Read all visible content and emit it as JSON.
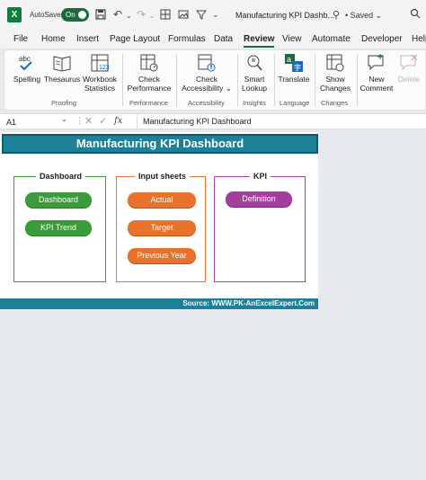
{
  "titlebar": {
    "app_logo": "X",
    "autosave_label": "AutoSave",
    "autosave_state": "On",
    "doc_title": "Manufacturing KPI Dashb...",
    "saved_status": "• Saved ⌄",
    "icons": [
      "save-icon",
      "undo-icon",
      "redo-icon",
      "table-icon",
      "image-icon",
      "filter-icon",
      "more-icon",
      "user-icon",
      "search-icon"
    ]
  },
  "menu": {
    "tabs": [
      "File",
      "Home",
      "Insert",
      "Page Layout",
      "Formulas",
      "Data",
      "Review",
      "View",
      "Automate",
      "Developer",
      "Help"
    ],
    "active": "Review"
  },
  "ribbon": {
    "spelling": "Spelling",
    "thesaurus": "Thesaurus",
    "workbook_stats_1": "Workbook",
    "workbook_stats_2": "Statistics",
    "proofing": "Proofing",
    "check_perf_1": "Check",
    "check_perf_2": "Performance",
    "performance": "Performance",
    "check_access_1": "Check",
    "check_access_2": "Accessibility ⌄",
    "accessibility": "Accessibility",
    "smart_lookup_1": "Smart",
    "smart_lookup_2": "Lookup",
    "insights": "Insights",
    "translate": "Translate",
    "language": "Language",
    "show_changes_1": "Show",
    "show_changes_2": "Changes",
    "changes": "Changes",
    "new_comment_1": "New",
    "new_comment_2": "Comment",
    "delete": "Delete",
    "abc_text": "abc"
  },
  "formula_bar": {
    "name_box": "A1",
    "fx": "fx",
    "content": "Manufacturing KPI Dashboard"
  },
  "dashboard": {
    "title": "Manufacturing KPI Dashboard",
    "footer": "Source: WWW.PK-AnExcelExpert.Com",
    "panels": [
      {
        "title": "Dashboard",
        "buttons": [
          "Dashboard",
          "KPI Trend"
        ],
        "color": "#3a9b3a"
      },
      {
        "title": "Input sheets",
        "buttons": [
          "Actual",
          "Target",
          "Previous Year"
        ],
        "color": "#e8722b"
      },
      {
        "title": "KPI",
        "buttons": [
          "Definition"
        ],
        "color": "#a43e9e"
      }
    ]
  },
  "colors": {
    "excel_green": "#107c41",
    "header_teal": "#1d7f98",
    "panel_green": "#3a9b3a",
    "panel_orange": "#e8722b",
    "panel_purple": "#a43e9e"
  }
}
